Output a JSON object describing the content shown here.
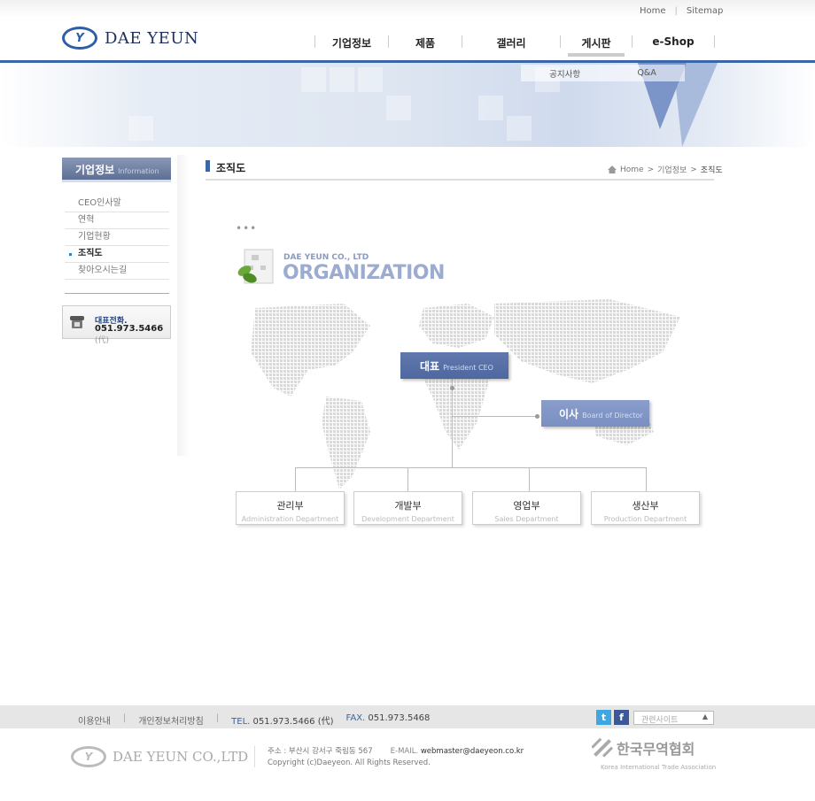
{
  "top_links": {
    "home": "Home",
    "sitemap": "Sitemap"
  },
  "brand": {
    "logo_letter": "Y",
    "name": "DAE YEUN"
  },
  "gnb": [
    "기업정보",
    "제품",
    "갤러리",
    "게시판",
    "e-Shop"
  ],
  "subnav": [
    "공지사항",
    "Q&A"
  ],
  "lnb": {
    "title": "기업정보",
    "title_en": "Information",
    "items": [
      "CEO인사말",
      "연혁",
      "기업현황",
      "조직도",
      "찾아오시는길"
    ],
    "active_index": 3
  },
  "tel_box": {
    "label": "대표전화.",
    "number": "051.973.5466",
    "suffix": "(代)"
  },
  "content": {
    "title": "조직도",
    "breadcrumb": [
      "Home",
      "기업정보",
      "조직도"
    ],
    "dots": "•••",
    "org_small": "DAE YEUN CO., LTD",
    "org_big": "ORGANIZATION"
  },
  "org": {
    "ceo": {
      "k": "대표",
      "e": "President CEO"
    },
    "director": {
      "k": "이사",
      "e": "Board of Director"
    },
    "depts": [
      {
        "k": "관리부",
        "e": "Administration Department"
      },
      {
        "k": "개발부",
        "e": "Development Department"
      },
      {
        "k": "영업부",
        "e": "Sales Department"
      },
      {
        "k": "생산부",
        "e": "Production Department"
      }
    ]
  },
  "footer": {
    "links": [
      "이용안내",
      "개인정보처리방침"
    ],
    "tel_label": "TEL.",
    "tel": "051.973.5466 (代)",
    "fax_label": "FAX.",
    "fax": "051.973.5468",
    "twitter": "t",
    "facebook": "f",
    "related": "관련사이트",
    "related_arrow": "▲",
    "company": "DAE YEUN CO.,LTD",
    "address": "주소 : 부산시 강서구 죽림동 567",
    "email_label": "E-MAIL.",
    "email": "webmaster@daeyeon.co.kr",
    "copyright": "Copyright (c)Daeyeon. All Rights Reserved.",
    "kita": "한국무역협회",
    "kita_en": "Korea International Trade Association"
  },
  "colors": {
    "brand": "#3a66a8",
    "ceo_box": "#5670a6",
    "director_box": "#8195c6"
  }
}
